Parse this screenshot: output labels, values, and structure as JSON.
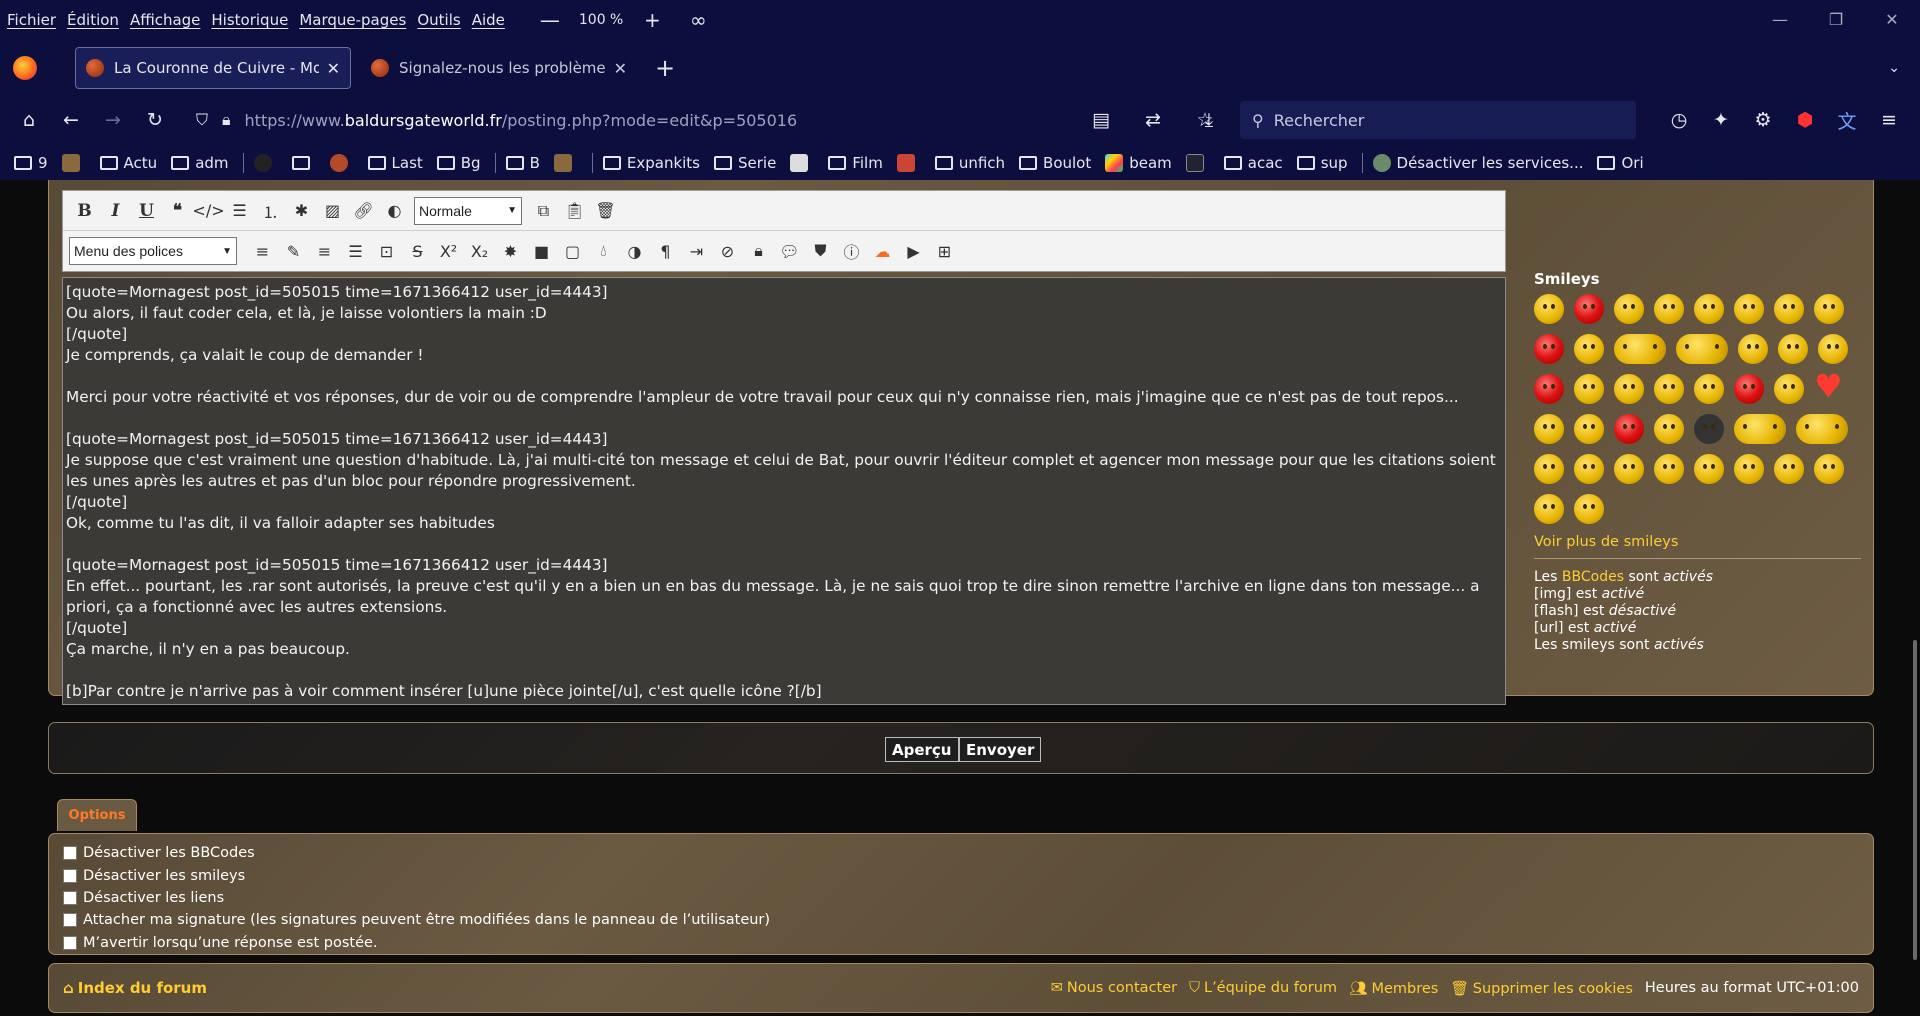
{
  "menubar": {
    "items": [
      "Fichier",
      "Édition",
      "Affichage",
      "Historique",
      "Marque-pages",
      "Outils",
      "Aide"
    ],
    "zoom_minus": "—",
    "zoom_level": "100 %",
    "zoom_plus": "+",
    "private_icon": "mask-icon"
  },
  "tabs": [
    {
      "title": "La Couronne de Cuivre - Modifier",
      "active": true
    },
    {
      "title": "Signalez-nous les problèmes liés",
      "active": false
    }
  ],
  "navbar": {
    "url_prefix": "https://www.",
    "url_host": "baldursgateworld.fr",
    "url_path": "/posting.php?mode=edit&p=505016",
    "search_placeholder": "Rechercher"
  },
  "bookmarks": [
    "9",
    "Actu",
    "adm",
    "Last",
    "Bg",
    "B",
    "Expankits",
    "Serie",
    "Film",
    "unfich",
    "Boulot",
    "beam",
    "acac",
    "sup",
    "Désactiver les services...",
    "Ori"
  ],
  "editor": {
    "size_select": "Normale",
    "font_select": "Menu des polices",
    "lines": [
      "[quote=Mornagest post_id=505015 time=1671366412 user_id=4443]",
      "Ou alors, il faut coder cela, et là, je laisse volontiers la main :D",
      "[/quote]",
      "Je comprends, ça valait le coup de demander !",
      "",
      "Merci pour votre réactivité et vos réponses, dur de voir ou de comprendre l'ampleur de votre travail pour ceux qui n'y connaisse rien, mais j'imagine que ce n'est pas de tout repos...",
      "",
      "[quote=Mornagest post_id=505015 time=1671366412 user_id=4443]",
      "Je suppose que c'est vraiment une question d'habitude. Là, j'ai multi-cité ton message et celui de Bat, pour ouvrir l'éditeur complet et agencer mon message pour que les citations soient les unes après les autres et pas d'un bloc pour répondre progressivement.",
      "[/quote]",
      "Ok, comme tu l'as dit, il va falloir adapter ses habitudes",
      "",
      "[quote=Mornagest post_id=505015 time=1671366412 user_id=4443]",
      "En effet... pourtant, les .rar sont autorisés, la preuve c'est qu'il y en a bien un en bas du message. Là, je ne sais quoi trop te dire sinon remettre l'archive en ligne dans ton message... a priori, ça a fonctionné avec les autres extensions.",
      "[/quote]",
      "Ça marche, il n'y en a pas beaucoup.",
      "",
      "[b]Par contre je n'arrive pas à voir comment insérer [u]une pièce jointe[/u], c'est quelle icône ?[/b]"
    ]
  },
  "smileys": {
    "heading": "Smileys",
    "more_link": "Voir plus de smileys",
    "info": {
      "l1_a": "Les ",
      "l1_link": "BBCodes",
      "l1_b": " sont ",
      "l1_state": "activés",
      "l2_a": "[img] est ",
      "l2_state": "activé",
      "l3_a": "[flash] est ",
      "l3_state": "désactivé",
      "l4_a": "[url] est ",
      "l4_state": "activé",
      "l5_a": "Les smileys sont ",
      "l5_state": "activés"
    }
  },
  "buttons": {
    "preview": "Aperçu",
    "submit": "Envoyer"
  },
  "options": {
    "tab_label": "Options",
    "items": [
      "Désactiver les BBCodes",
      "Désactiver les smileys",
      "Désactiver les liens",
      "Attacher ma signature (les signatures peuvent être modifiées dans le panneau de l’utilisateur)",
      "M’avertir lorsqu’une réponse est postée."
    ]
  },
  "footer": {
    "index": "Index du forum",
    "contact": "Nous contacter",
    "team": "L’équipe du forum",
    "members": "Membres",
    "cookies": "Supprimer les cookies",
    "timezone_label": "Heures au format ",
    "timezone_value": "UTC+01:00"
  }
}
